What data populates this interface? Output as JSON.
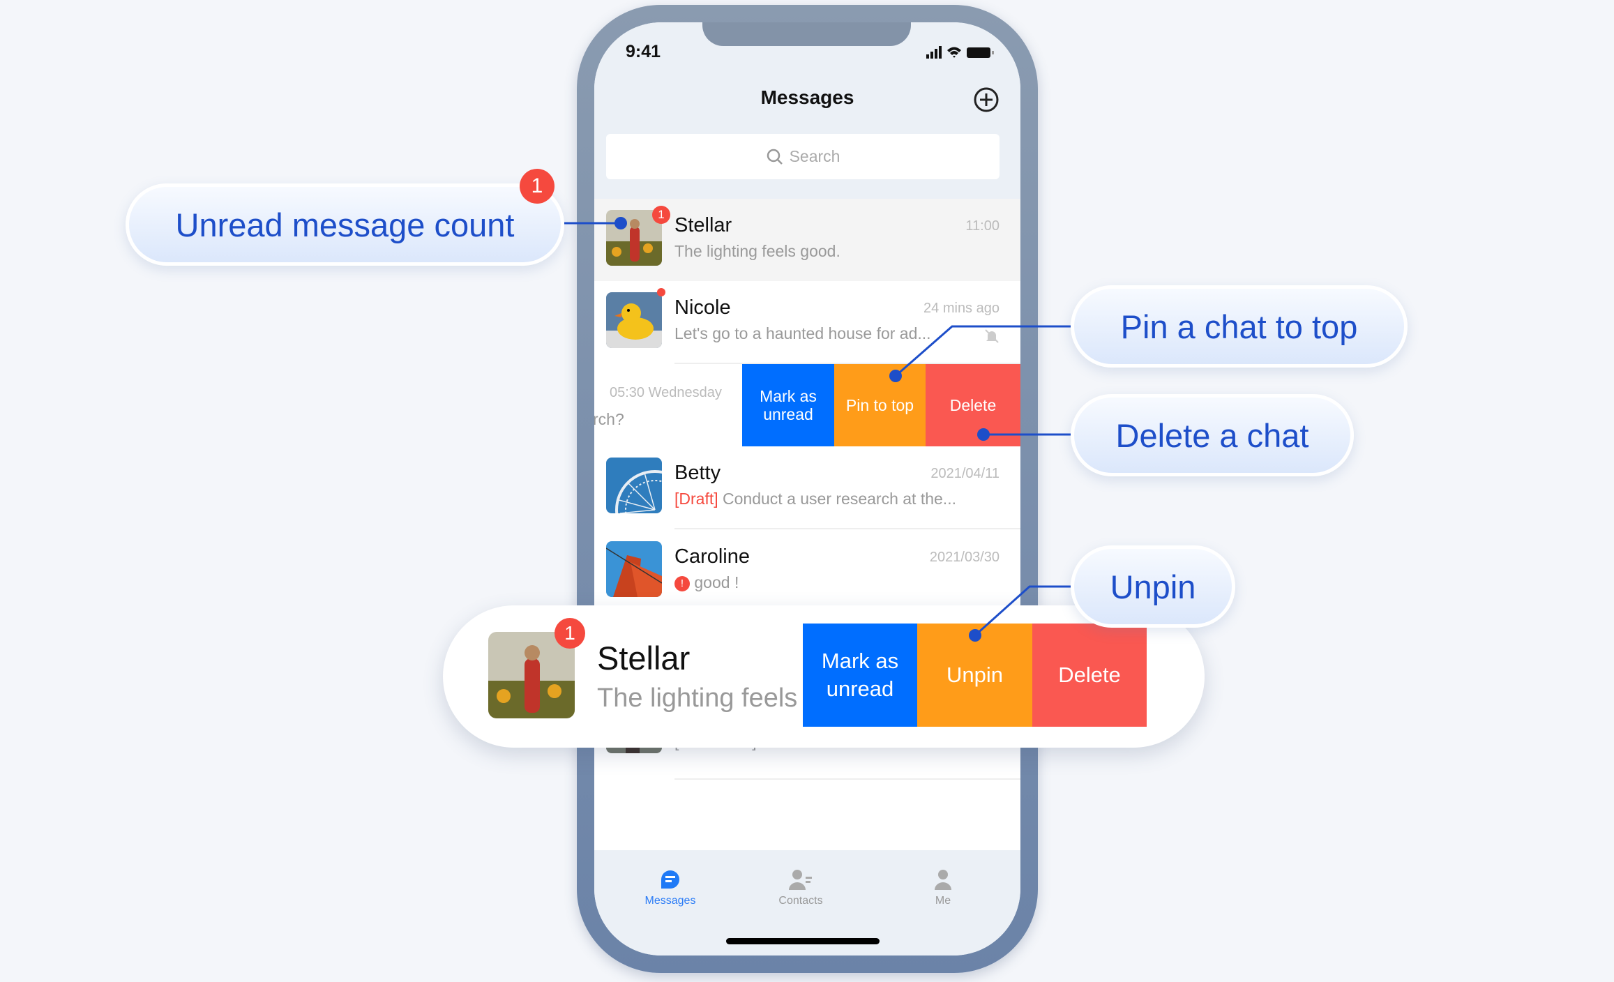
{
  "status": {
    "time": "9:41"
  },
  "header": {
    "title": "Messages",
    "search_placeholder": "Search"
  },
  "chats": [
    {
      "name": "Stellar",
      "preview": "The lighting feels good.",
      "time": "11:00",
      "unread": "1"
    },
    {
      "name": "Nicole",
      "preview": "Let's go to a haunted house for ad...",
      "time": "24 mins ago",
      "muted": true
    },
    {
      "time": "05:30 Wednesday",
      "preview": "rch?",
      "actions": [
        "Mark as unread",
        "Pin to top",
        "Delete"
      ]
    },
    {
      "name": "Betty",
      "draft_tag": "[Draft]",
      "preview": "Conduct a user research at the...",
      "time": "2021/04/11"
    },
    {
      "name": "Caroline",
      "preview": "good !",
      "time": "2021/03/30",
      "error": "!"
    },
    {
      "preview": "[Document] new 5.txt"
    }
  ],
  "tabs": [
    {
      "label": "Messages",
      "active": true
    },
    {
      "label": "Contacts"
    },
    {
      "label": "Me"
    }
  ],
  "popup": {
    "name": "Stellar",
    "preview": "The lighting feels good.",
    "unread": "1",
    "actions": [
      "Mark as unread",
      "Unpin",
      "Delete"
    ]
  },
  "callouts": {
    "unread": "Unread message count",
    "unread_badge": "1",
    "pin": "Pin a chat to top",
    "delete": "Delete a chat",
    "unpin": "Unpin"
  },
  "colors": {
    "blue": "#006eff",
    "orange": "#ff9c19",
    "red": "#fa5851",
    "callout_text": "#1d4ec9"
  }
}
